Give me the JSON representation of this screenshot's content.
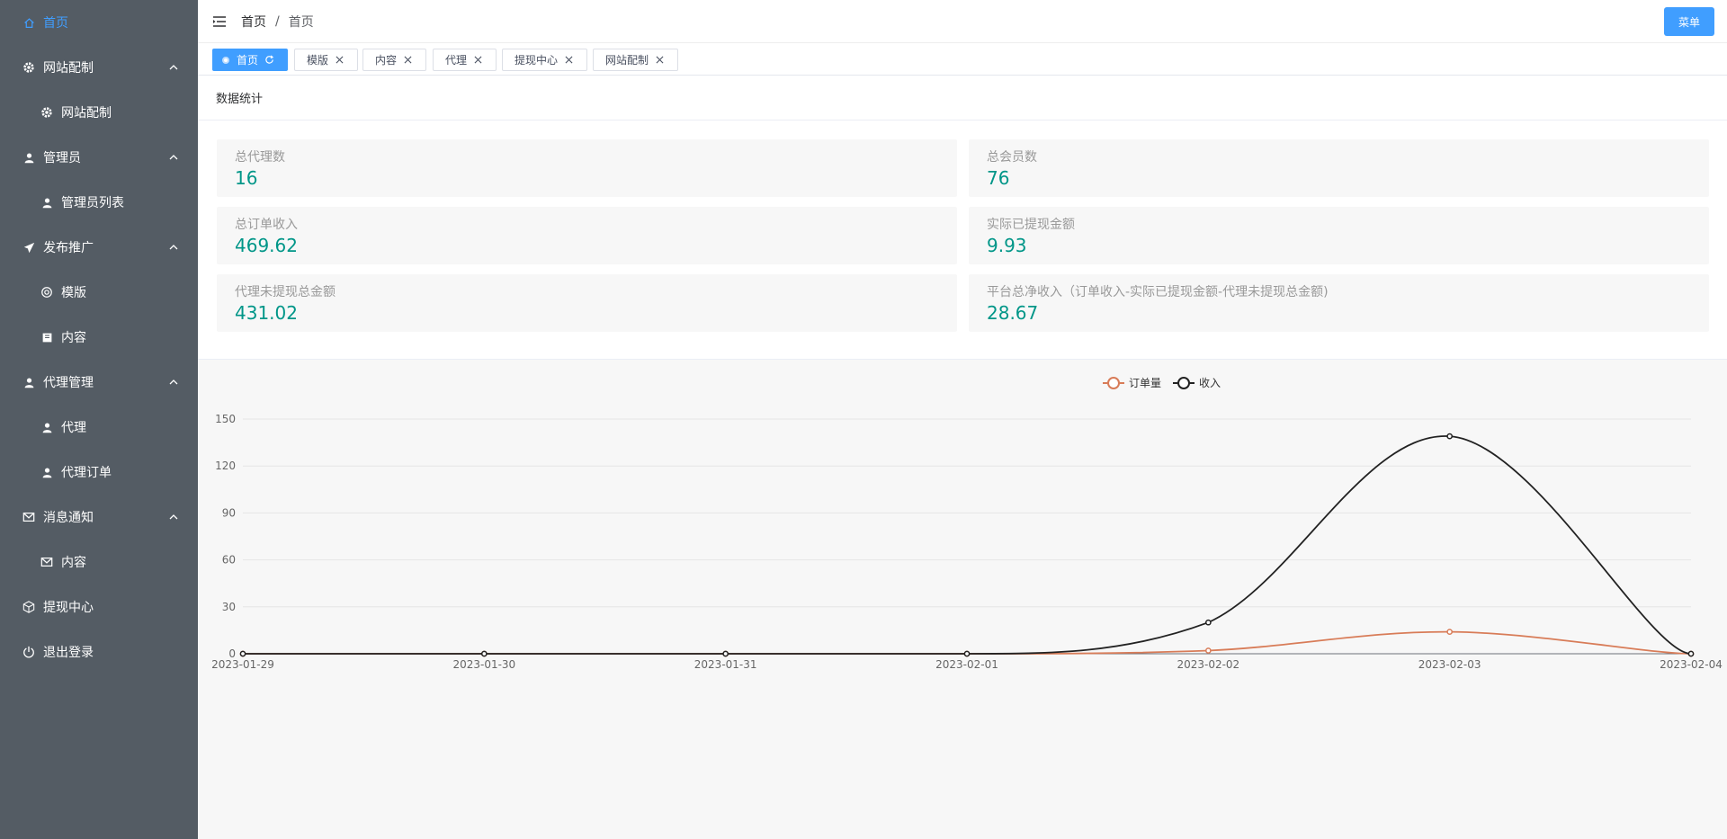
{
  "sidebar": {
    "items": [
      {
        "label": "首页",
        "icon": "home-icon",
        "active": true
      },
      {
        "label": "网站配制",
        "icon": "gear-icon",
        "expanded": true
      },
      {
        "label": "网站配制",
        "icon": "gear-icon"
      },
      {
        "label": "管理员",
        "icon": "user-icon",
        "expanded": true
      },
      {
        "label": "管理员列表",
        "icon": "user-icon"
      },
      {
        "label": "发布推广",
        "icon": "send-icon",
        "expanded": true
      },
      {
        "label": "模版",
        "icon": "template-icon"
      },
      {
        "label": "内容",
        "icon": "document-icon"
      },
      {
        "label": "代理管理",
        "icon": "user-icon",
        "expanded": true
      },
      {
        "label": "代理",
        "icon": "user-icon"
      },
      {
        "label": "代理订单",
        "icon": "user-icon"
      },
      {
        "label": "消息通知",
        "icon": "mail-icon",
        "expanded": true
      },
      {
        "label": "内容",
        "icon": "mail-icon"
      },
      {
        "label": "提现中心",
        "icon": "box-icon"
      },
      {
        "label": "退出登录",
        "icon": "power-icon"
      }
    ]
  },
  "header": {
    "breadcrumb": {
      "home": "首页",
      "separator": "/",
      "current": "首页"
    },
    "menu_button": "菜单"
  },
  "tabs": [
    {
      "label": "首页",
      "active": true
    },
    {
      "label": "模版"
    },
    {
      "label": "内容"
    },
    {
      "label": "代理"
    },
    {
      "label": "提现中心"
    },
    {
      "label": "网站配制"
    }
  ],
  "stats": {
    "title": "数据统计",
    "items": [
      {
        "label": "总代理数",
        "value": "16"
      },
      {
        "label": "总会员数",
        "value": "76"
      },
      {
        "label": "总订单收入",
        "value": "469.62"
      },
      {
        "label": "实际已提现金额",
        "value": "9.93"
      },
      {
        "label": "代理未提现总金额",
        "value": "431.02"
      },
      {
        "label": "平台总净收入（订单收入-实际已提现金额-代理未提现总金额)",
        "value": "28.67"
      }
    ]
  },
  "colors": {
    "sidebar_bg": "#545c64",
    "accent": "#409eff",
    "stat_value": "#009688",
    "series_orders": "#d87c58",
    "series_income": "#222222"
  },
  "chart_data": {
    "type": "line",
    "x": [
      "2023-01-29",
      "2023-01-30",
      "2023-01-31",
      "2023-02-01",
      "2023-02-02",
      "2023-02-03",
      "2023-02-04"
    ],
    "series": [
      {
        "name": "订单量",
        "values": [
          0,
          0,
          0,
          0,
          2,
          14,
          0
        ]
      },
      {
        "name": "收入",
        "values": [
          0,
          0,
          0,
          0,
          20,
          139,
          0
        ]
      }
    ],
    "yticks": [
      0,
      30,
      60,
      90,
      120,
      150
    ],
    "ylim": [
      0,
      150
    ],
    "smooth": true,
    "grid": true,
    "legend": "top-center"
  }
}
